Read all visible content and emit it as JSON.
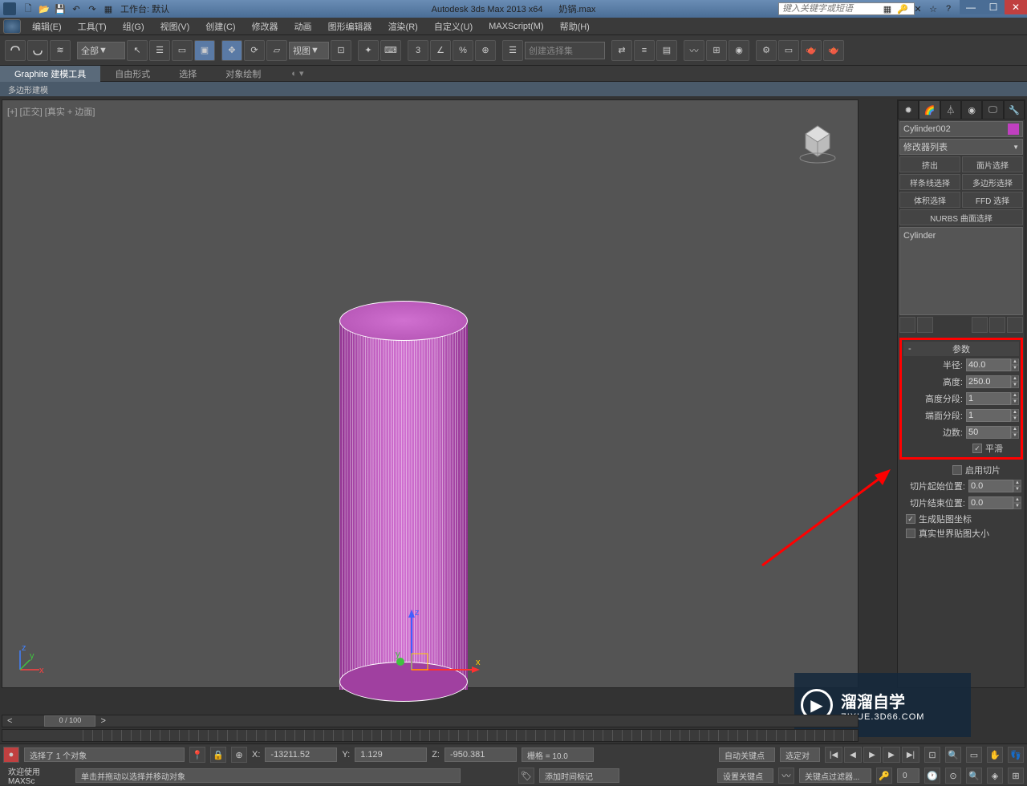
{
  "titlebar": {
    "workspace_label": "工作台: 默认",
    "app_title": "Autodesk 3ds Max  2013 x64",
    "file_name": "奶锅.max",
    "search_placeholder": "键入关键字或短语"
  },
  "menubar": {
    "items": [
      "编辑(E)",
      "工具(T)",
      "组(G)",
      "视图(V)",
      "创建(C)",
      "修改器",
      "动画",
      "图形编辑器",
      "渲染(R)",
      "自定义(U)",
      "MAXScript(M)",
      "帮助(H)"
    ]
  },
  "maintoolbar": {
    "selection_filter": "全部",
    "view_label": "视图",
    "named_sets_placeholder": "创建选择集"
  },
  "ribbon": {
    "tabs": [
      "Graphite 建模工具",
      "自由形式",
      "选择",
      "对象绘制"
    ],
    "subtab": "多边形建模"
  },
  "viewport": {
    "label": "[+] [正交] [真实 + 边面]"
  },
  "cmdpanel": {
    "object_name": "Cylinder002",
    "modifier_list_label": "修改器列表",
    "mod_buttons": [
      "挤出",
      "面片选择",
      "样条线选择",
      "多边形选择",
      "体积选择",
      "FFD 选择"
    ],
    "nurbs_btn": "NURBS 曲面选择",
    "stack_item": "Cylinder",
    "rollouts": {
      "params_title": "参数",
      "radius_label": "半径:",
      "radius_value": "40.0",
      "height_label": "高度:",
      "height_value": "250.0",
      "height_segs_label": "高度分段:",
      "height_segs_value": "1",
      "cap_segs_label": "端面分段:",
      "cap_segs_value": "1",
      "sides_label": "边数:",
      "sides_value": "50",
      "smooth_label": "平滑",
      "slice_on_label": "启用切片",
      "slice_from_label": "切片起始位置:",
      "slice_from_value": "0.0",
      "slice_to_label": "切片结束位置:",
      "slice_to_value": "0.0",
      "gen_coords_label": "生成贴图坐标",
      "real_world_label": "真实世界贴图大小"
    }
  },
  "timeslider": {
    "frame_label": "0 / 100"
  },
  "statusbar": {
    "welcome": "欢迎使用  MAXSc",
    "selected_text": "选择了 1 个对象",
    "prompt_text": "单击并拖动以选择并移动对象",
    "x_label": "X:",
    "x_value": "-13211.52",
    "y_label": "Y:",
    "y_value": "1.129",
    "z_label": "Z:",
    "z_value": "-950.381",
    "grid_label": "栅格 = 10.0",
    "add_time_tag": "添加时间标记",
    "auto_key": "自动关键点",
    "set_key": "设置关键点",
    "selected_filter": "选定对",
    "key_filters": "关键点过滤器..."
  },
  "watermark": {
    "title": "溜溜自学",
    "url": "ZIXUE.3D66.COM"
  }
}
